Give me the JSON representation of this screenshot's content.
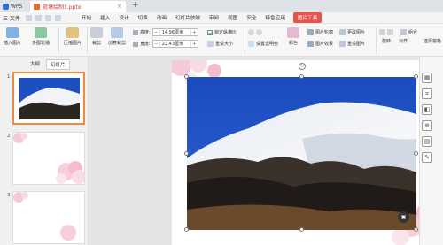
{
  "titlebar": {
    "app_tab": "WPS",
    "doc_tab": "荷塘绘制1.pptx"
  },
  "menubar": {
    "file_label": "三 文件",
    "items": [
      "开始",
      "插入",
      "设计",
      "切换",
      "动画",
      "幻灯片放映",
      "审阅",
      "视图",
      "安全",
      "特色应用"
    ],
    "active_tab": "图片工具"
  },
  "ribbon": {
    "insert_picture": "插入图片",
    "multi_picture": "多图轮播",
    "compress_picture": "压缩图片",
    "crop": "裁剪",
    "creative_crop": "创意裁剪",
    "height_label": "高度:",
    "height_value": "14.96厘米",
    "width_label": "宽度:",
    "width_value": "22.43厘米",
    "lock_ratio": "锁定纵横比",
    "reset_size": "重设大小",
    "set_transparent": "设置透明色",
    "color": "颜色",
    "picture_outline": "图片轮廓",
    "picture_effects": "图片效果",
    "change_picture": "更改图片",
    "reset_picture": "重设图片",
    "combine": "组合",
    "rotate": "旋转",
    "align": "对齐",
    "selection_pane": "选择窗格"
  },
  "leftpanel": {
    "tabs": [
      "大纲",
      "幻灯片"
    ],
    "slides": [
      "1",
      "2",
      "3"
    ]
  },
  "colors": {
    "accent": "#e8534a",
    "selection": "#f08a40",
    "sky": "#1e4fc0"
  }
}
